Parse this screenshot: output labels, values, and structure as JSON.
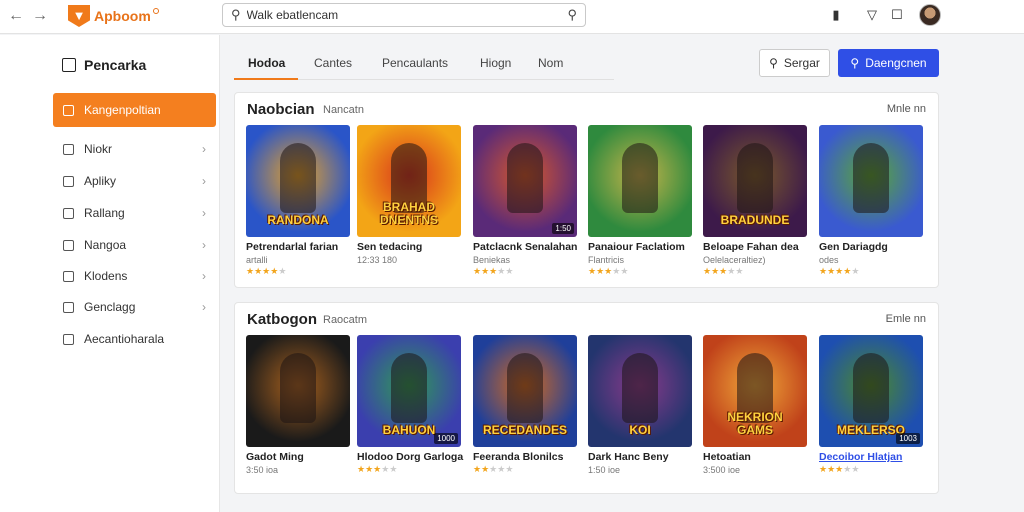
{
  "app": {
    "title": "Apboom"
  },
  "search": {
    "value": "Walk ebatlencam"
  },
  "sidebar": {
    "title": "Pencarka",
    "items": [
      {
        "label": "Kangenpoltian",
        "active": true,
        "chevron": false
      },
      {
        "label": "Niokr",
        "active": false,
        "chevron": true
      },
      {
        "label": "Apliky",
        "active": false,
        "chevron": true
      },
      {
        "label": "Rallang",
        "active": false,
        "chevron": true
      },
      {
        "label": "Nangoa",
        "active": false,
        "chevron": true
      },
      {
        "label": "Klodens",
        "active": false,
        "chevron": true
      },
      {
        "label": "Genclagg",
        "active": false,
        "chevron": true
      },
      {
        "label": "Aecantioharala",
        "active": false,
        "chevron": false
      }
    ]
  },
  "tabs": [
    {
      "label": "Hodoa",
      "active": true
    },
    {
      "label": "Cantes",
      "active": false
    },
    {
      "label": "Pencaulants",
      "active": false
    },
    {
      "label": "Hiogn",
      "active": false
    },
    {
      "label": "Nom",
      "active": false
    }
  ],
  "actions": {
    "outline": "Sergar",
    "primary": "Daengcnen"
  },
  "sections": [
    {
      "title": "Naobcian",
      "subtitle": "Nancatn",
      "more": "Mnle nn",
      "cards": [
        {
          "thumb_text": "RANDONA",
          "badge": "",
          "title": "Petrendarlal farian",
          "sub": "artalli",
          "stars": 4,
          "colors": [
            "#2a55c8",
            "#e7a226"
          ]
        },
        {
          "thumb_text": "BRAHAD DNENTNS",
          "badge": "",
          "title": "Sen tedacing",
          "sub": "12:33 180",
          "stars": 0,
          "colors": [
            "#f3a516",
            "#d8351b"
          ]
        },
        {
          "thumb_text": "",
          "badge": "1:50",
          "title": "Patclacnk Senalahan",
          "sub": "Beniekas",
          "stars": 3,
          "colors": [
            "#5a2a78",
            "#d8582a"
          ]
        },
        {
          "thumb_text": "",
          "badge": "",
          "title": "Panaiour Faclatiom",
          "sub": "Flantricis",
          "stars": 3,
          "colors": [
            "#2f8a3e",
            "#c7b44a"
          ]
        },
        {
          "thumb_text": "BRADUNDE",
          "badge": "",
          "title": "Beloape Fahan dea",
          "sub": "Oelelaceraltiez)",
          "stars": 3,
          "colors": [
            "#3d1a4a",
            "#7a5a2a"
          ]
        },
        {
          "thumb_text": "",
          "badge": "",
          "title": "Gen Dariagdg",
          "sub": "odes",
          "stars": 4,
          "colors": [
            "#3a5ad0",
            "#5aa833"
          ]
        }
      ]
    },
    {
      "title": "Katbogon",
      "subtitle": "Raocatm",
      "more": "Emle nn",
      "cards": [
        {
          "thumb_text": "",
          "badge": "",
          "title": "Gadot Ming",
          "sub": "3:50 ioa",
          "stars": 0,
          "colors": [
            "#1a1a1a",
            "#a8611e"
          ]
        },
        {
          "thumb_text": "BAHUON",
          "badge": "1000",
          "title": "Hlodoo Dorg Garloga",
          "sub": "",
          "stars": 3,
          "colors": [
            "#3b3fae",
            "#2f9b54"
          ]
        },
        {
          "thumb_text": "RECEDANDES",
          "badge": "",
          "title": "Feeranda Blonilcs",
          "sub": "",
          "stars": 2,
          "colors": [
            "#1f3f9a",
            "#d46a1d"
          ]
        },
        {
          "thumb_text": "KOI",
          "badge": "",
          "title": "Dark Hanc Beny",
          "sub": "1:50 ioe",
          "stars": 0,
          "colors": [
            "#23356e",
            "#8a3a8a"
          ]
        },
        {
          "thumb_text": "NEKRION GAMS",
          "badge": "",
          "title": "Hetoatian",
          "sub": "3:500 ioe",
          "stars": 0,
          "colors": [
            "#c0421a",
            "#f0a83a"
          ]
        },
        {
          "thumb_text": "MEKLERSO",
          "badge": "1003",
          "title": "Decoibor Hlatjan",
          "sub": "",
          "stars": 3,
          "colors": [
            "#1e4fb0",
            "#4c8a2a"
          ],
          "link": true
        }
      ]
    }
  ]
}
